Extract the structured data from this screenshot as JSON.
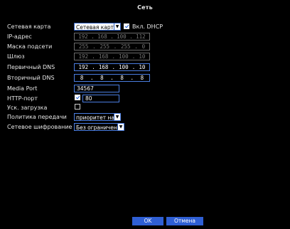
{
  "window": {
    "title": "Сеть"
  },
  "rows": {
    "network_card": {
      "label": "Сетевая карта",
      "value": "Сетевая карт",
      "dhcp_label": "Вкл. DHCP"
    },
    "ip": {
      "label": "IP-адрес",
      "octets": [
        "192",
        "168",
        "100",
        "112"
      ]
    },
    "mask": {
      "label": "Маска подсети",
      "octets": [
        "255",
        "255",
        "255",
        "0"
      ]
    },
    "gateway": {
      "label": "Шлюз",
      "octets": [
        "192",
        "168",
        "100",
        "10"
      ]
    },
    "dns1": {
      "label": "Первичный DNS",
      "octets": [
        "192",
        "168",
        "100",
        "10"
      ]
    },
    "dns2": {
      "label": "Вторичный DNS",
      "octets": [
        "8",
        "8",
        "8",
        "8"
      ]
    },
    "media_port": {
      "label": "Media Port",
      "value": "34567"
    },
    "http_port": {
      "label": "HTTP-порт",
      "value": "80"
    },
    "fast_load": {
      "label": "Уск. загрузка"
    },
    "transfer_policy": {
      "label": "Политика передачи",
      "value": "приоритет на"
    },
    "encryption": {
      "label": "Сетевое шифрование",
      "value": "Без ограничений"
    }
  },
  "buttons": {
    "ok": "OK",
    "cancel": "Отмена"
  },
  "colors": {
    "accent": "#2f5fd4",
    "focus_border": "#4a7de0",
    "background": "#000000"
  }
}
